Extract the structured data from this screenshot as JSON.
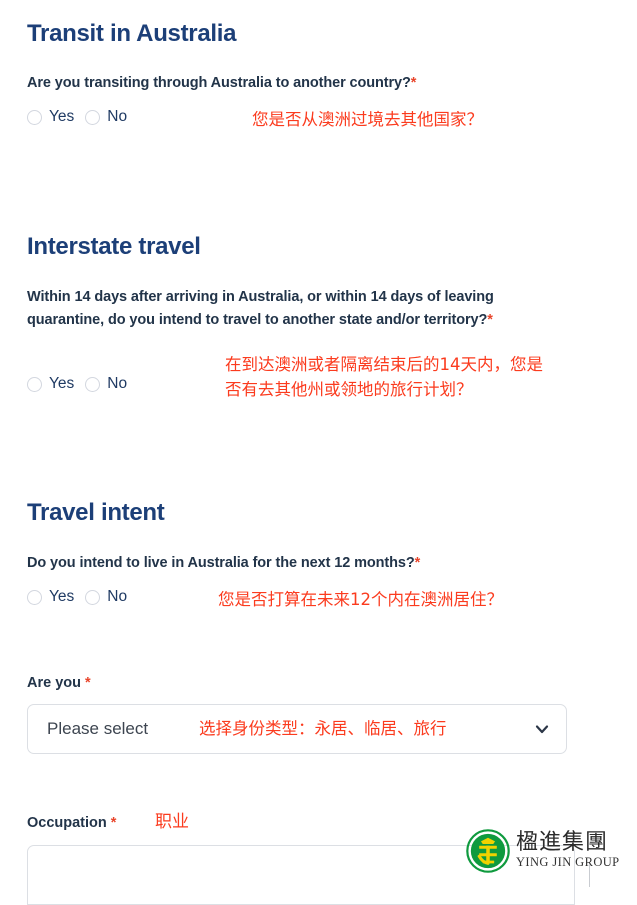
{
  "sections": [
    {
      "heading": "Transit in Australia",
      "question": "Are you transiting through Australia to another country?",
      "required_mark": "*",
      "options": [
        {
          "label": "Yes"
        },
        {
          "label": "No"
        }
      ],
      "annotation": "您是否从澳洲过境去其他国家？"
    },
    {
      "heading": "Interstate travel",
      "question": "Within 14 days after arriving in Australia, or within 14 days of leaving quarantine, do you intend to travel to another state and/or territory?",
      "required_mark": "*",
      "options": [
        {
          "label": "Yes"
        },
        {
          "label": "No"
        }
      ],
      "annotation": "在到达澳洲或者隔离结束后的14天内，您是\n否有去其他州或领地的旅行计划？"
    },
    {
      "heading": "Travel intent",
      "question": "Do you intend to live in Australia for the next 12 months?",
      "required_mark": "*",
      "options": [
        {
          "label": "Yes"
        },
        {
          "label": "No"
        }
      ],
      "annotation": "您是否打算在未来12个内在澳洲居住？"
    }
  ],
  "are_you_field": {
    "label": "Are you",
    "required_mark": "*",
    "selected_value": "Please select",
    "placeholder": "Please select",
    "annotation": "选择身份类型：永居、临居、旅行",
    "chevron_icon": "chevron-down-icon"
  },
  "occupation_field": {
    "label": "Occupation",
    "required_mark": "*",
    "annotation": "职业",
    "value": ""
  },
  "watermark": {
    "logo_icon": "ying-jin-group-logo-icon",
    "chinese_name": "楹進集團",
    "english_name": "YING JIN GROUP"
  },
  "colors": {
    "heading": "#1c3f78",
    "question": "#223449",
    "required": "#e8442a",
    "annotation": "#fb3b1e",
    "radio_label": "#1f3a63",
    "border": "#dcdfe4",
    "logo_green": "#0f9a3e",
    "logo_gold": "#f0d200"
  }
}
